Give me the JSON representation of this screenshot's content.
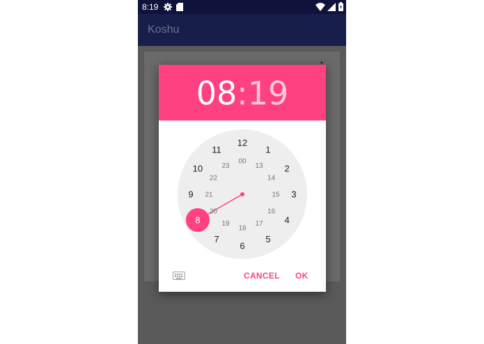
{
  "status_bar": {
    "time": "8:19"
  },
  "app_bar": {
    "title": "Koshu"
  },
  "time_picker": {
    "hour": "08",
    "separator": ":",
    "minute": "19",
    "selected_hour": "8",
    "outer_numbers": [
      "12",
      "1",
      "2",
      "3",
      "4",
      "5",
      "6",
      "7",
      "8",
      "9",
      "10",
      "11"
    ],
    "inner_numbers": [
      "00",
      "13",
      "14",
      "15",
      "16",
      "17",
      "18",
      "19",
      "20",
      "21",
      "22",
      "23"
    ],
    "cancel_label": "CANCEL",
    "ok_label": "OK"
  },
  "colors": {
    "accent": "#ff4081",
    "status_bar": "#0d133a",
    "app_bar": "#171e4a",
    "clock_face": "#eeeeee"
  },
  "icons": [
    "settings-gear-icon",
    "sd-card-icon",
    "wifi-icon",
    "signal-icon",
    "battery-icon",
    "overflow-menu-icon",
    "keyboard-icon"
  ]
}
